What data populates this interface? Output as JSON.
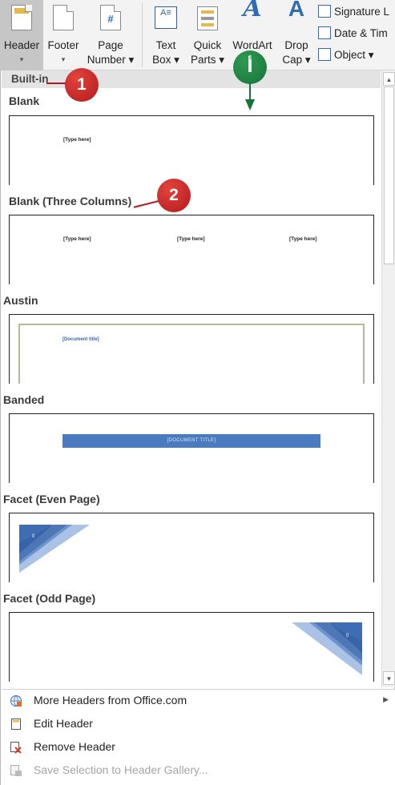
{
  "ribbon": {
    "header": {
      "label": "Header",
      "caret": "▾"
    },
    "footer": {
      "label": "Footer",
      "caret": "▾"
    },
    "page_number": {
      "label1": "Page",
      "label2": "Number ▾",
      "glyph": "#"
    },
    "text_box": {
      "label1": "Text",
      "label2": "Box ▾"
    },
    "quick_parts": {
      "label1": "Quick",
      "label2": "Parts ▾"
    },
    "wordart": {
      "label": "WordArt",
      "glyph": "A"
    },
    "drop_cap": {
      "label1": "Drop",
      "label2": "Cap ▾",
      "glyph": "A"
    },
    "signature": {
      "label": "Signature L"
    },
    "date_time": {
      "label": "Date & Tim"
    },
    "object": {
      "label": "Object ▾"
    }
  },
  "gallery": {
    "section_label": "Built-in",
    "items": [
      {
        "name": "Blank",
        "placeholders": [
          "[Type here]"
        ]
      },
      {
        "name": "Blank (Three Columns)",
        "placeholders": [
          "[Type here]",
          "[Type here]",
          "[Type here]"
        ]
      },
      {
        "name": "Austin",
        "placeholders": [
          "[Document title]"
        ]
      },
      {
        "name": "Banded",
        "placeholders": [
          "[DOCUMENT TITLE]"
        ]
      },
      {
        "name": "Facet (Even Page)",
        "placeholders": [
          "0"
        ]
      },
      {
        "name": "Facet (Odd Page)",
        "placeholders": [
          "0"
        ]
      }
    ]
  },
  "menu": {
    "more_headers": "More Headers from Office.com",
    "edit_header": "Edit Header",
    "remove_header": "Remove Header",
    "save_selection": "Save Selection to Header Gallery..."
  },
  "callouts": {
    "one": "1",
    "two": "2",
    "a": "أ"
  },
  "colors": {
    "callout_red": "#b3191e",
    "callout_green": "#16733a",
    "accent_blue": "#2e6db4",
    "band_blue": "#4a7bc0"
  }
}
